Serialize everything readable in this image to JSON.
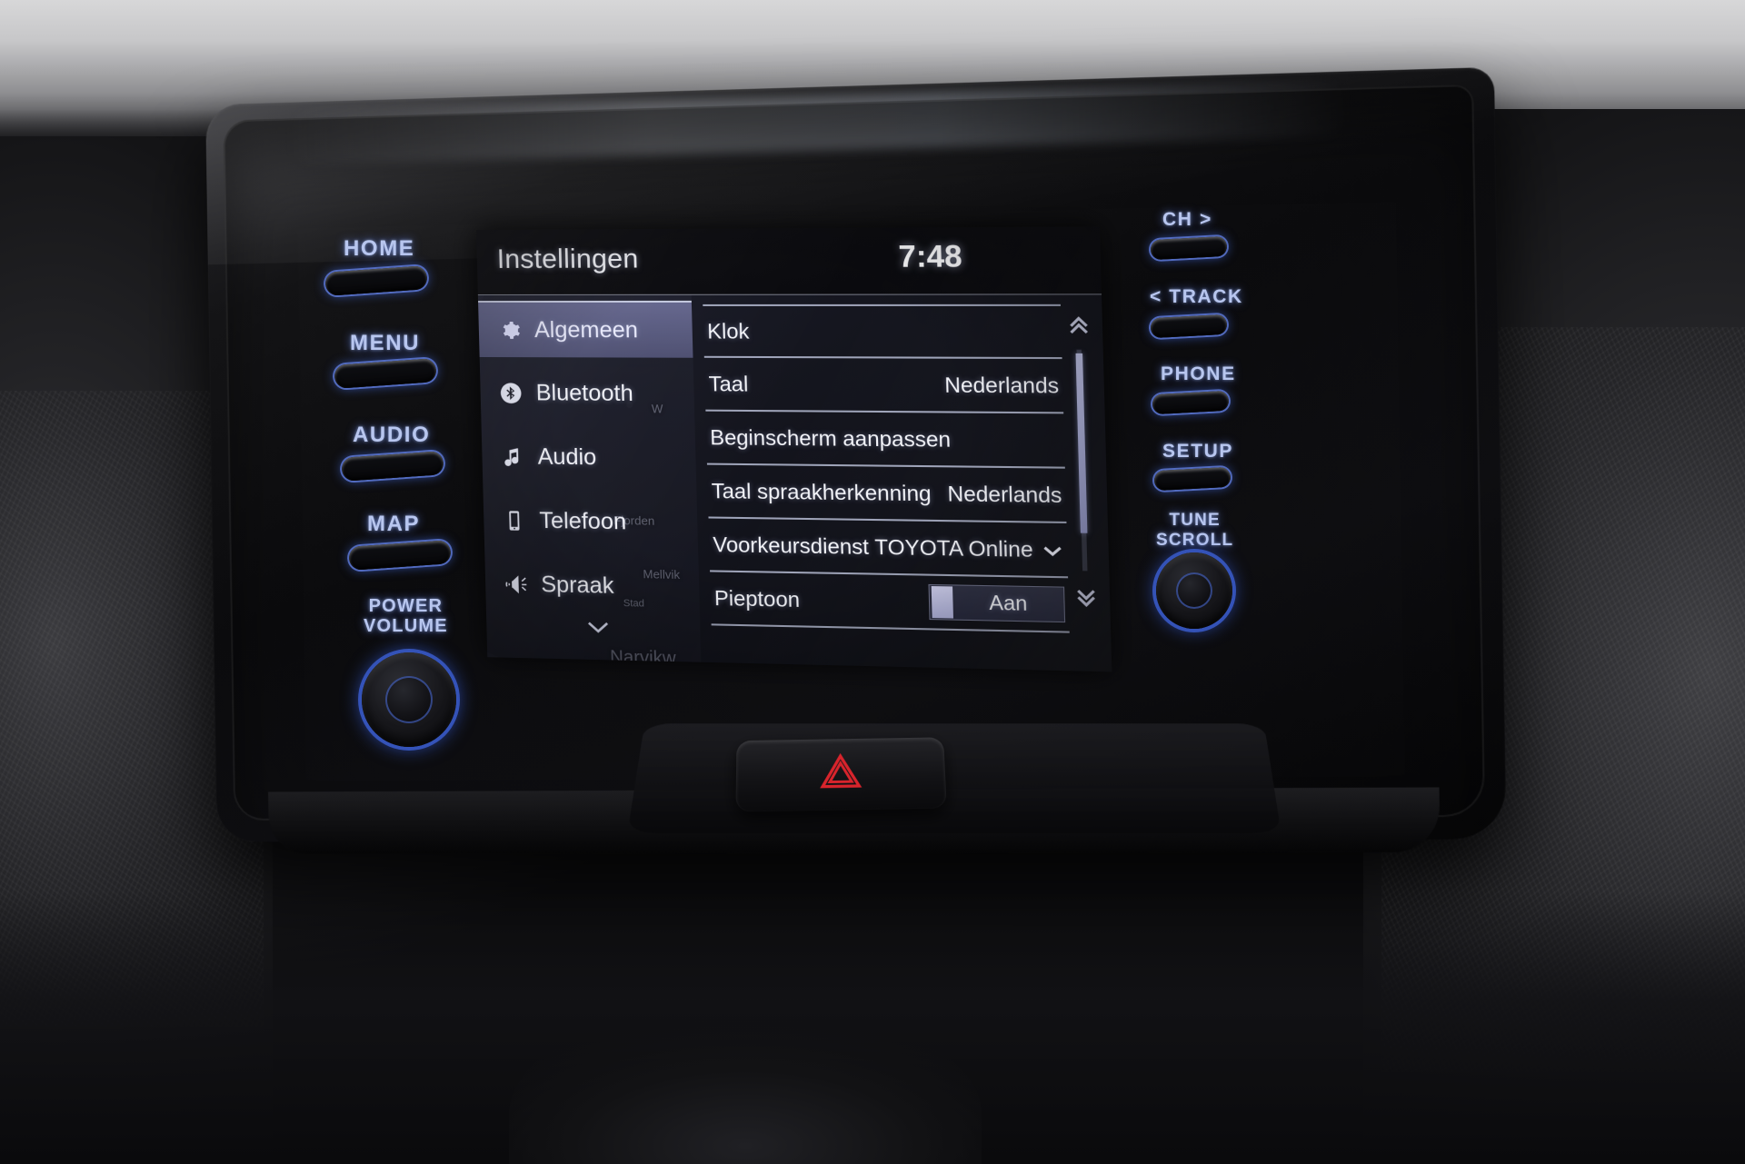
{
  "device": {
    "name": "Toyota Yaris multimedia head unit",
    "accent_blue": "#5a78e6",
    "screen_bg": "#15161f"
  },
  "screen": {
    "title": "Instellingen",
    "clock": "7:48",
    "sidebar": {
      "items": [
        {
          "label": "Algemeen",
          "icon": "gear-icon",
          "active": true
        },
        {
          "label": "Bluetooth",
          "icon": "bluetooth-icon",
          "active": false
        },
        {
          "label": "Audio",
          "icon": "music-note-icon",
          "active": false
        },
        {
          "label": "Telefoon",
          "icon": "phone-icon",
          "active": false
        },
        {
          "label": "Spraak",
          "icon": "voice-icon",
          "active": false
        }
      ],
      "more_icon": "chevron-down-icon",
      "map_labels": [
        "W",
        "Fjorden",
        "Narvikw",
        "Mellvik",
        "Stad"
      ]
    },
    "rows": [
      {
        "label": "Klok",
        "value": "",
        "type": "link"
      },
      {
        "label": "Taal",
        "value": "Nederlands",
        "type": "value"
      },
      {
        "label": "Beginscherm aanpassen",
        "value": "",
        "type": "link"
      },
      {
        "label": "Taal spraakherkenning",
        "value": "Nederlands",
        "type": "value"
      },
      {
        "label": "Voorkeursdienst",
        "value": "TOYOTA Online",
        "type": "dropdown"
      },
      {
        "label": "Pieptoon",
        "value": "Aan",
        "type": "toggle"
      }
    ],
    "scrollbar": {
      "up_icon": "double-chevron-up-icon",
      "down_icon": "double-chevron-down-icon"
    }
  },
  "hardware": {
    "left_buttons": [
      {
        "label": "HOME"
      },
      {
        "label": "MENU"
      },
      {
        "label": "AUDIO"
      },
      {
        "label": "MAP"
      }
    ],
    "left_knob": {
      "line1": "POWER",
      "line2": "VOLUME"
    },
    "right_buttons": [
      {
        "label": "CH >"
      },
      {
        "label": "< TRACK"
      },
      {
        "label": "PHONE"
      },
      {
        "label": "SETUP"
      }
    ],
    "right_knob": {
      "line1": "TUNE",
      "line2": "SCROLL"
    },
    "hazard": {
      "icon": "hazard-triangle-icon"
    }
  }
}
